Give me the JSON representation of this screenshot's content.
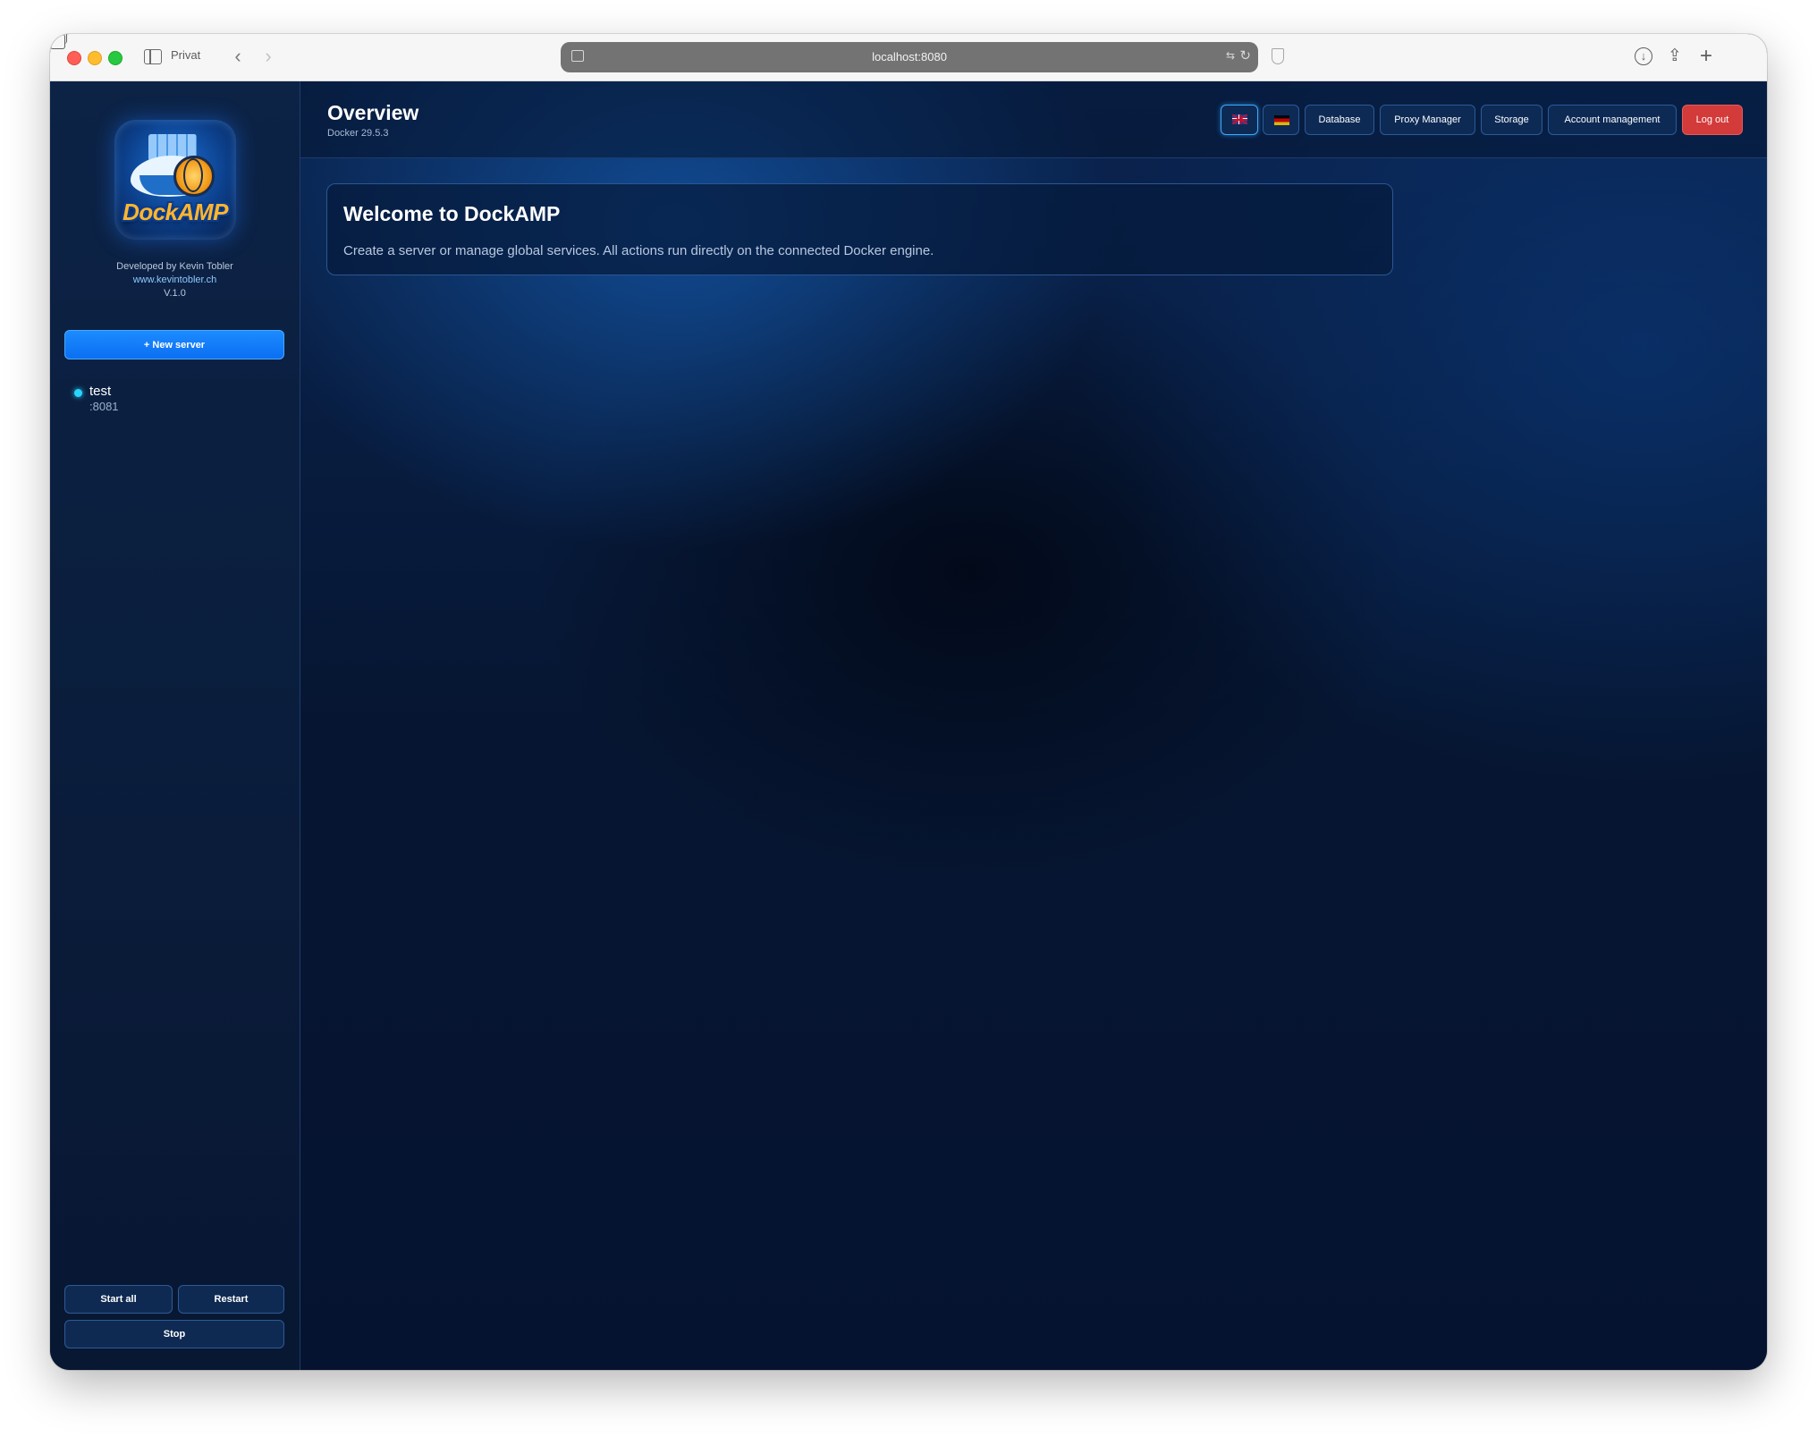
{
  "browser": {
    "mode_label": "Privat",
    "url": "localhost:8080"
  },
  "sidebar": {
    "logo_text": "DockAMP",
    "developer": "Developed by Kevin Tobler",
    "website": "www.kevintobler.ch",
    "version": "V.1.0",
    "new_server_label": "+ New server",
    "servers": [
      {
        "name": "test",
        "port": ":8081",
        "status_color": "#29d4ff"
      }
    ],
    "start_all_label": "Start all",
    "restart_label": "Restart",
    "stop_label": "Stop"
  },
  "header": {
    "title": "Overview",
    "subtitle": "Docker 29.5.3",
    "language_options": [
      "en-flag-icon",
      "de-flag-icon"
    ],
    "active_language": "en",
    "nav": {
      "database": "Database",
      "proxy_manager": "Proxy Manager",
      "storage": "Storage",
      "account_management": "Account management",
      "logout": "Log out"
    }
  },
  "welcome": {
    "title": "Welcome to DockAMP",
    "text": "Create a server or manage global services. All actions run directly on the connected Docker engine."
  },
  "colors": {
    "accent": "#0a6ef2",
    "logout": "#d33a3a",
    "background": "#071a36"
  }
}
